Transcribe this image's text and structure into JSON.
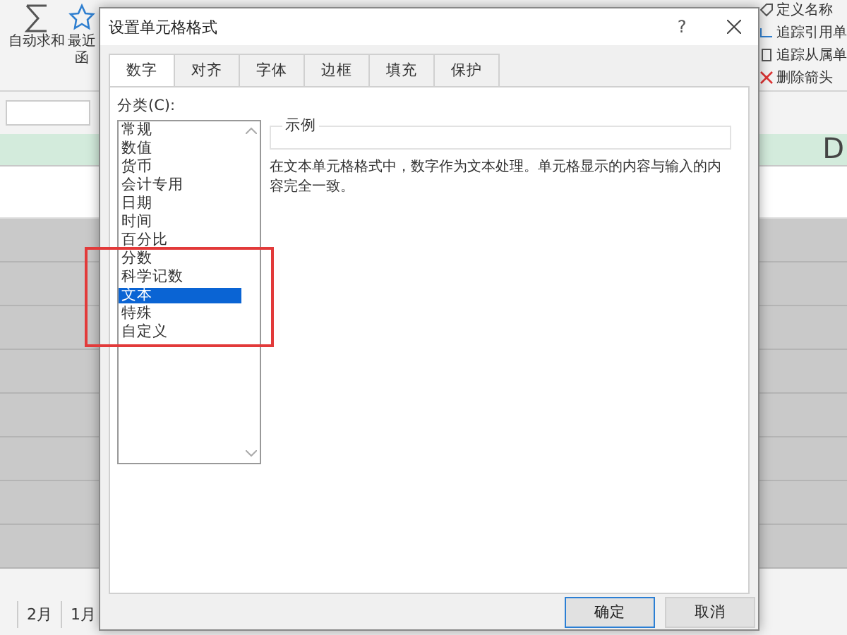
{
  "ribbon": {
    "buttons": [
      {
        "label": "自动求和",
        "kind": "sum"
      },
      {
        "label": "最近",
        "sublabel": "函",
        "kind": "recent"
      }
    ],
    "right_items": [
      {
        "label": "定义名称",
        "kind": "tag"
      },
      {
        "label": "追踪引用单",
        "kind": "trace"
      },
      {
        "label": "追踪从属单",
        "kind": "dependents"
      },
      {
        "label": "删除箭头",
        "kind": "remove"
      }
    ]
  },
  "sheet": {
    "column_header": "D",
    "tabs": [
      "2月",
      "1月"
    ]
  },
  "dialog": {
    "title": "设置单元格格式",
    "help": "?",
    "tabs": [
      {
        "label": "数字",
        "selected": true
      },
      {
        "label": "对齐",
        "selected": false
      },
      {
        "label": "字体",
        "selected": false
      },
      {
        "label": "边框",
        "selected": false
      },
      {
        "label": "填充",
        "selected": false
      },
      {
        "label": "保护",
        "selected": false
      }
    ],
    "category_label": "分类(C):",
    "categories": [
      {
        "label": "常规",
        "selected": false
      },
      {
        "label": "数值",
        "selected": false
      },
      {
        "label": "货币",
        "selected": false
      },
      {
        "label": "会计专用",
        "selected": false
      },
      {
        "label": "日期",
        "selected": false
      },
      {
        "label": "时间",
        "selected": false
      },
      {
        "label": "百分比",
        "selected": false
      },
      {
        "label": "分数",
        "selected": false
      },
      {
        "label": "科学记数",
        "selected": false
      },
      {
        "label": "文本",
        "selected": true
      },
      {
        "label": "特殊",
        "selected": false
      },
      {
        "label": "自定义",
        "selected": false
      }
    ],
    "sample_label": "示例",
    "description": "在文本单元格格式中，数字作为文本处理。单元格显示的内容与输入的内容完全一致。",
    "buttons": [
      {
        "label": "确定",
        "default": true
      },
      {
        "label": "取消",
        "default": false
      }
    ]
  }
}
